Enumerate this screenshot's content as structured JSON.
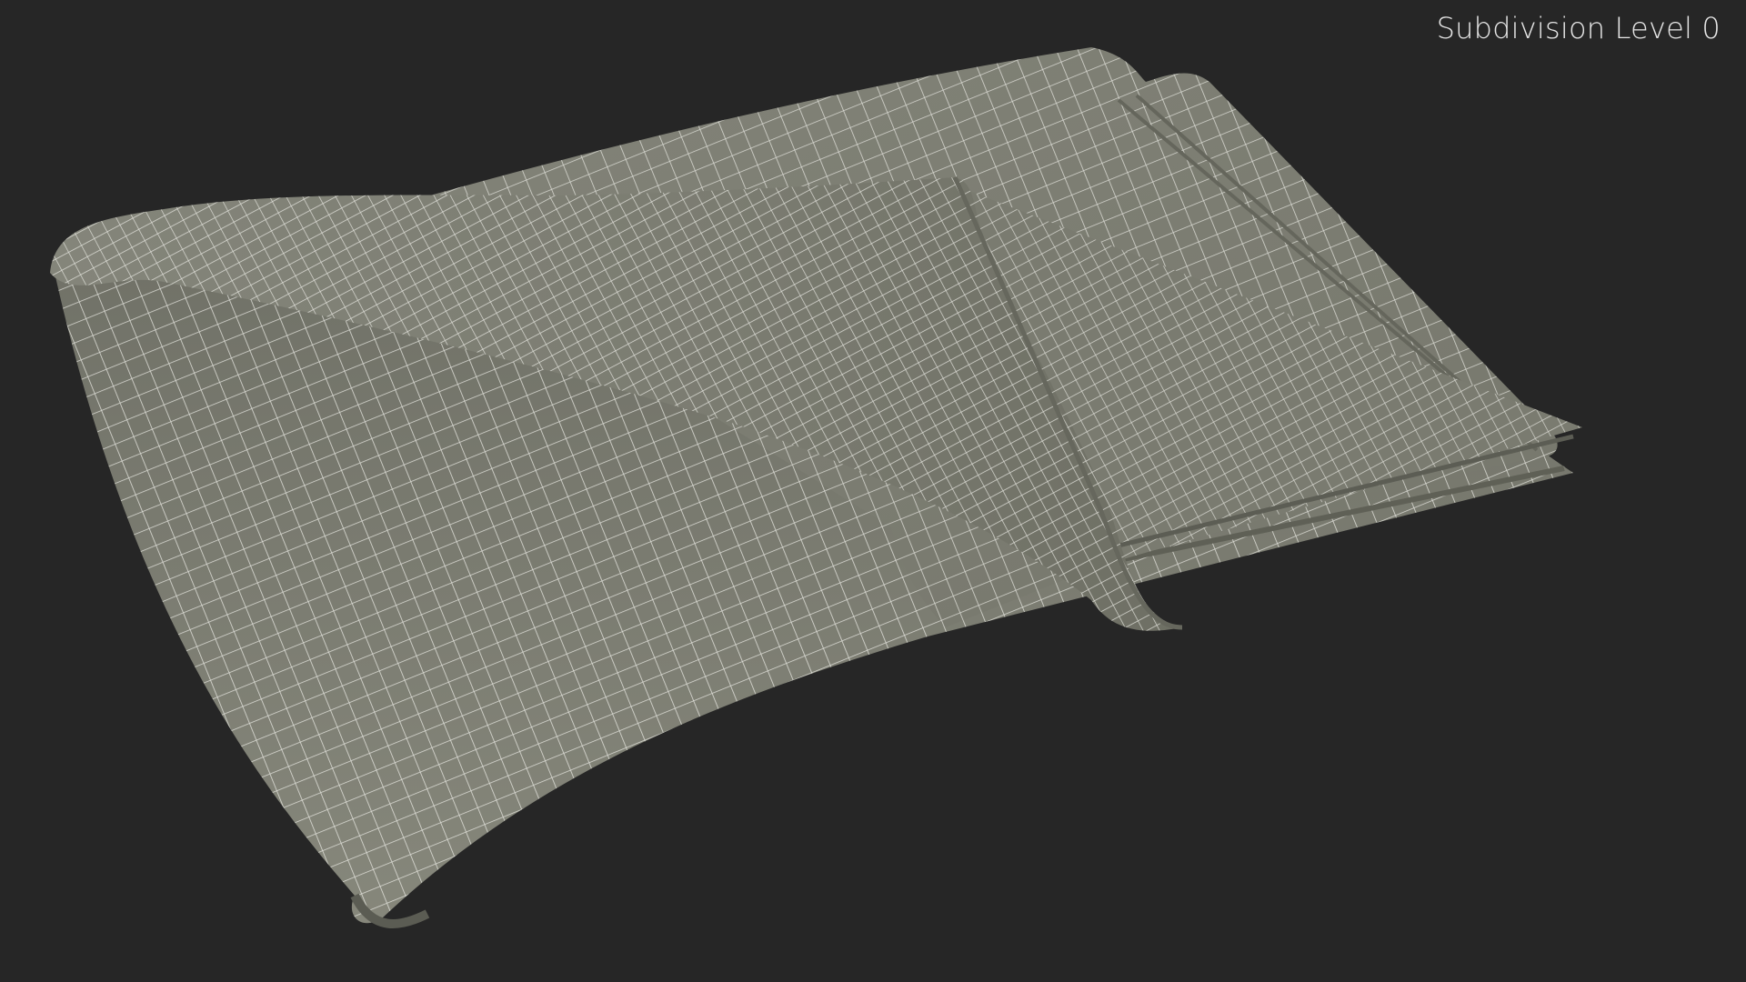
{
  "viewport": {
    "subdivision_label": "Subdivision Level 0",
    "background_color": "#262626",
    "mesh_color": "#7e7f74",
    "wire_color": "#eeeeea"
  }
}
